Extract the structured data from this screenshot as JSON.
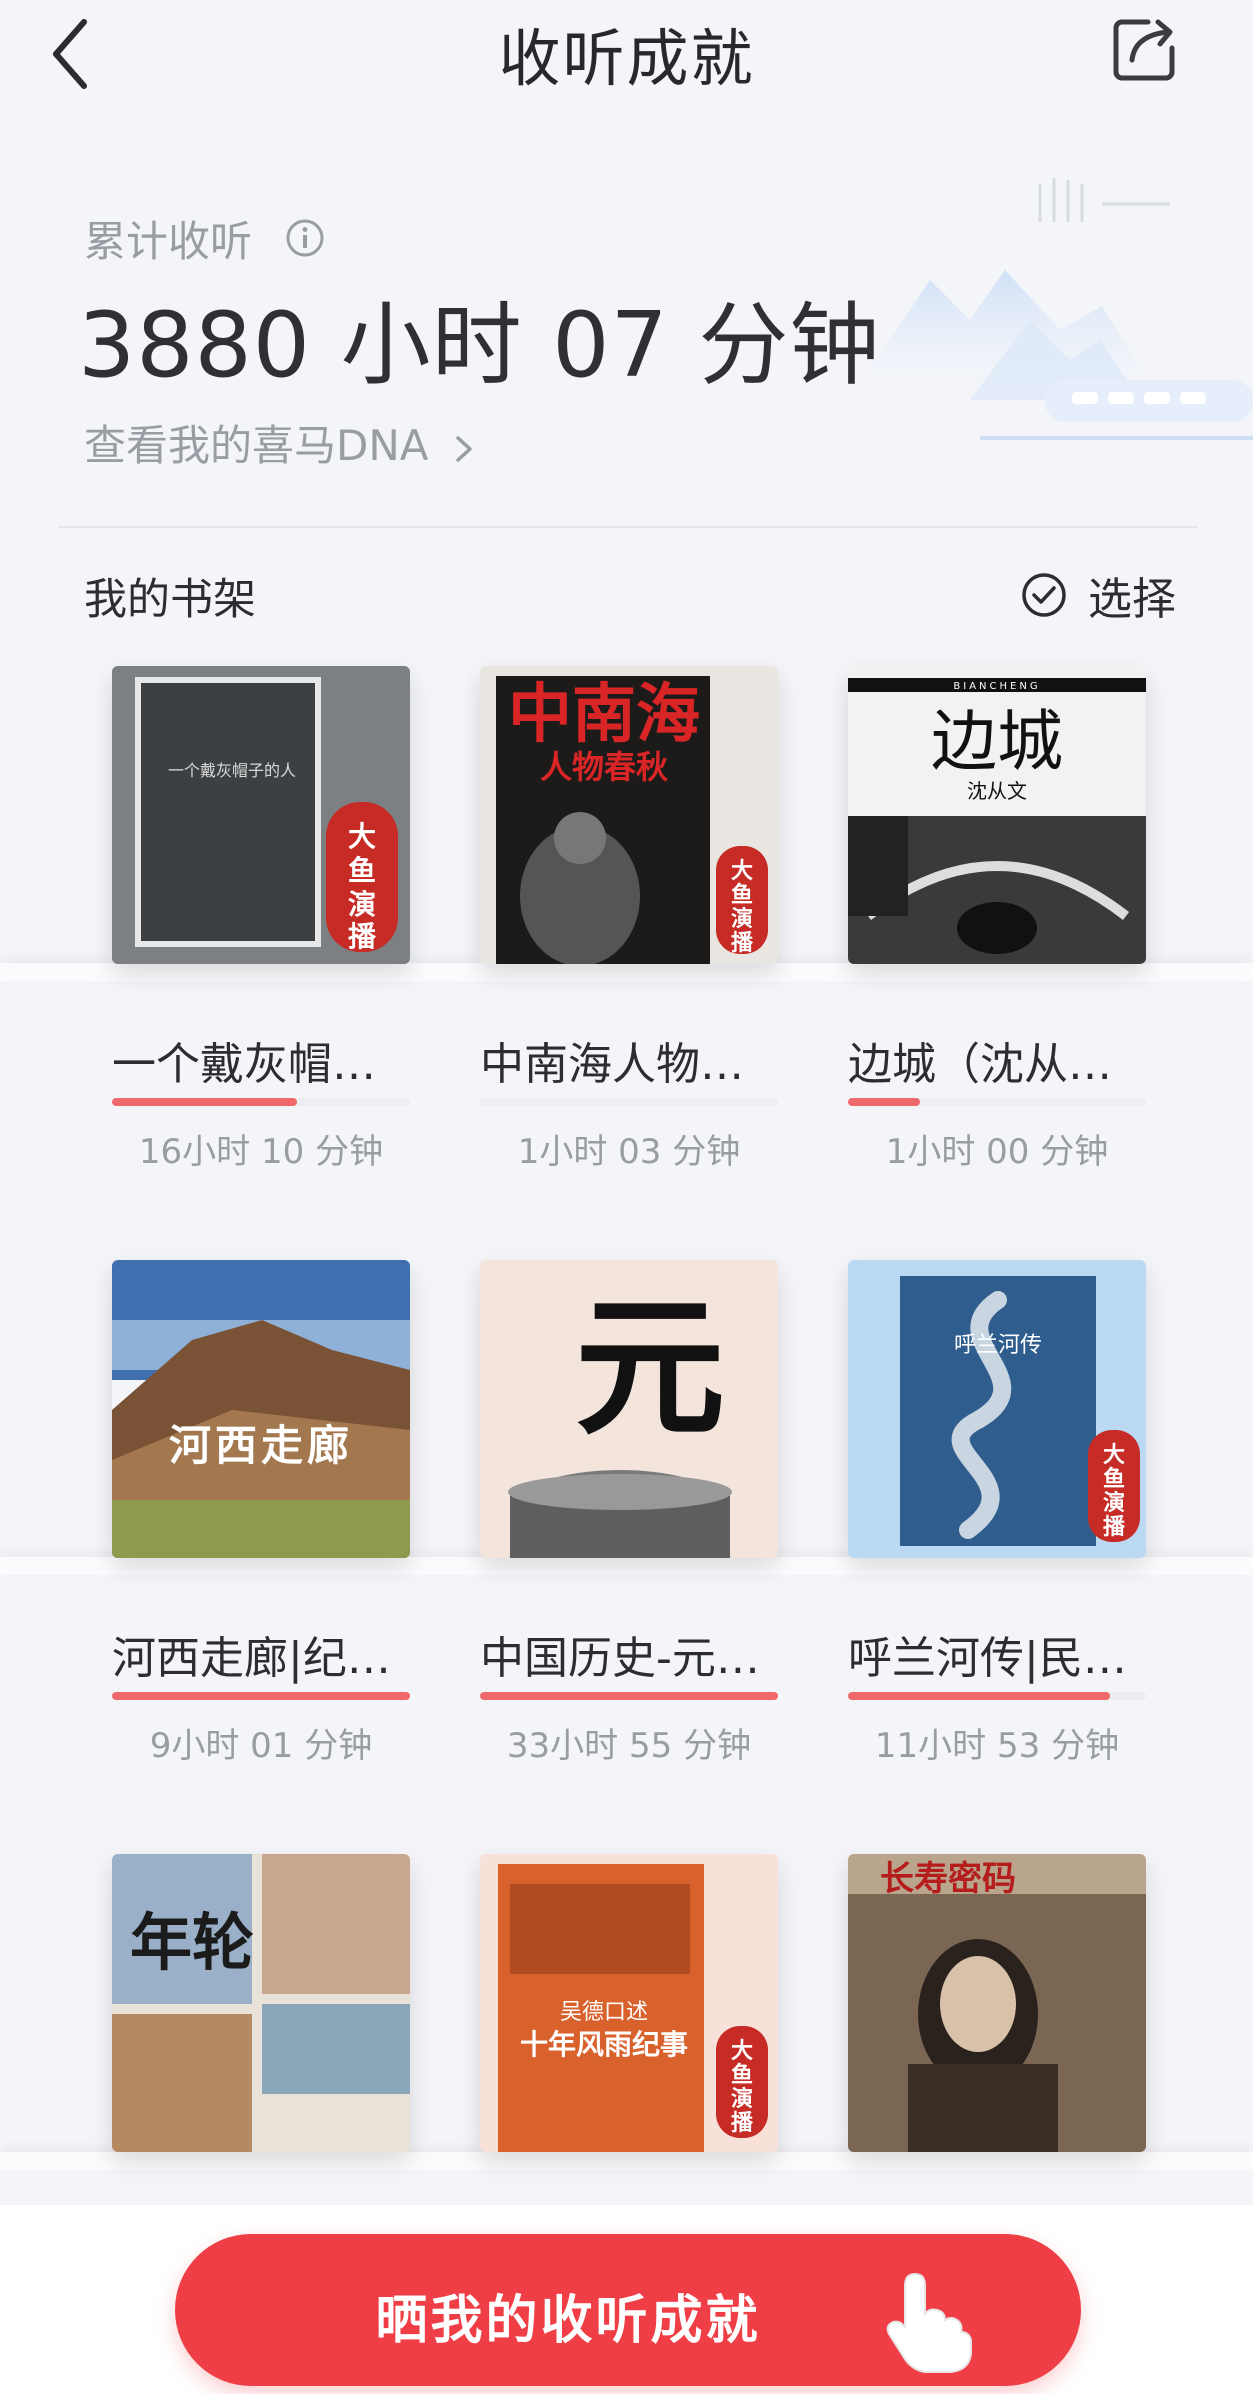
{
  "header": {
    "title": "收听成就"
  },
  "summary": {
    "label": "累计收听",
    "total_time": "3880 小时 07 分钟",
    "dna_link": "查看我的喜马DNA"
  },
  "shelf": {
    "title": "我的书架",
    "select_label": "选择",
    "books": [
      {
        "title": "一个戴灰帽…",
        "time": "16小时 10 分钟",
        "progress": 0.62
      },
      {
        "title": "中南海人物…",
        "time": "1小时 03 分钟",
        "progress": 0.0
      },
      {
        "title": "边城（沈从…",
        "time": "1小时 00 分钟",
        "progress": 0.24
      },
      {
        "title": "河西走廊|纪…",
        "time": "9小时 01 分钟",
        "progress": 1.0
      },
      {
        "title": "中国历史-元…",
        "time": "33小时 55 分钟",
        "progress": 1.0
      },
      {
        "title": "呼兰河传|民…",
        "time": "11小时 53 分钟",
        "progress": 0.88
      },
      {
        "title": "",
        "time": "",
        "progress": 0
      },
      {
        "title": "",
        "time": "",
        "progress": 0
      },
      {
        "title": "",
        "time": "",
        "progress": 0
      }
    ],
    "cover_texts": {
      "c0_badge": "大鱼演播",
      "c0_text": "一个戴灰帽子的人",
      "c1_title": "中南海",
      "c1_sub": "人物春秋",
      "c1_badge": "大鱼演播",
      "c2_title": "边城",
      "c2_author": "沈从文",
      "c2_top": "BIANCHENG",
      "c3_text": "河西走廊",
      "c4_char": "元",
      "c5_title": "呼兰河传",
      "c5_badge": "大鱼演播",
      "c6_title": "年轮",
      "c7_top": "吴德口述",
      "c7_title": "十年风雨纪事",
      "c7_badge": "大鱼演播",
      "c8_title": "长寿密码"
    }
  },
  "cta": {
    "label": "晒我的收听成就"
  },
  "colors": {
    "accent": "#ef3e45",
    "progress": "#f0696a"
  }
}
